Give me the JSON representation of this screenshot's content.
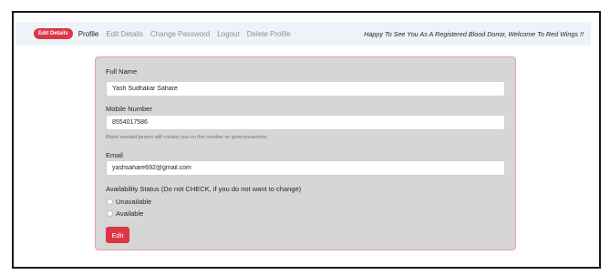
{
  "nav": {
    "badge": "Edit Details",
    "links": [
      "Profile",
      "Edit Details",
      "Change Password",
      "Logout",
      "Delete Profile"
    ],
    "welcome": "Happy To See You As A Registered Blood Donor, Welcome To Red Wings !!"
  },
  "form": {
    "full_name_label": "Full Name",
    "full_name_value": "Yash Sudhakar Sahare",
    "mobile_label": "Mobile Number",
    "mobile_value": "8554017586",
    "mobile_help": "Blood needed person will contact you on this number so giveconnectone.",
    "email_label": "Email",
    "email_value": "yashsahare692@gmail.com",
    "availability_label": "Availability Status (Do not CHECK, if you do not want to change)",
    "options": [
      "Unavailable",
      "Available"
    ],
    "submit_label": "Edit"
  },
  "colors": {
    "accent": "#dc3545",
    "navbar_bg": "#eef3fa",
    "card_bg": "#d6d6d6"
  }
}
